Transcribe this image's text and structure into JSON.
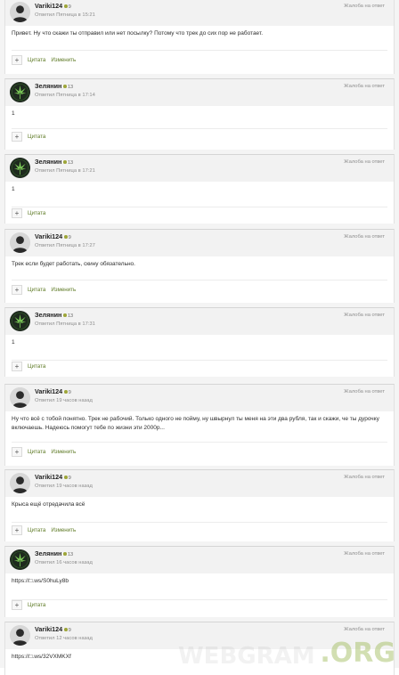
{
  "labels": {
    "report": "Жалоба на ответ",
    "quote": "Цитата",
    "edit": "Изменить"
  },
  "posts": [
    {
      "author": "Variki124",
      "rep": "9",
      "meta": "Ответил Пятница в 15:21",
      "text": "Привет. Ну что скажи ты отправил или нет посылку? Потому что трек до сих пор не работает.",
      "avatar": "user-avatar-gray",
      "can_edit": true
    },
    {
      "author": "Зелянин",
      "rep": "13",
      "meta": "Ответил Пятница в 17:14",
      "text": "1",
      "avatar": "cannabis-leaf-avatar",
      "can_edit": false
    },
    {
      "author": "Зелянин",
      "rep": "13",
      "meta": "Ответил Пятница в 17:21",
      "text": "1",
      "avatar": "cannabis-leaf-avatar",
      "can_edit": false
    },
    {
      "author": "Variki124",
      "rep": "9",
      "meta": "Ответил Пятница в 17:27",
      "text": "Трек если будет работать, скину обязательно.",
      "avatar": "user-avatar-gray",
      "can_edit": true
    },
    {
      "author": "Зелянин",
      "rep": "13",
      "meta": "Ответил Пятница в 17:31",
      "text": "1",
      "avatar": "cannabis-leaf-avatar",
      "can_edit": false
    },
    {
      "author": "Variki124",
      "rep": "9",
      "meta": "Ответил 19 часов назад",
      "text": "Ну что всё с тобой понятно. Трек не рабочий. Только одного не пойму, ну швырнул ты меня на эти два рубля, так и скажи, че ты дурочку включаешь. Надеюсь помогут тебе по жизни эти 2000р...",
      "avatar": "user-avatar-gray",
      "can_edit": true
    },
    {
      "author": "Variki124",
      "rep": "9",
      "meta": "Ответил 19 часов назад",
      "text": "Крыса ещё отредачила всё",
      "avatar": "user-avatar-gray",
      "can_edit": true
    },
    {
      "author": "Зелянин",
      "rep": "13",
      "meta": "Ответил 16 часов назад",
      "text": "https://□.ws/S0huLy8b",
      "avatar": "cannabis-leaf-avatar",
      "can_edit": false
    },
    {
      "author": "Variki124",
      "rep": "9",
      "meta": "Ответил 12 часов назад",
      "text": "https://□.ws/32VXMKXf",
      "avatar": "user-avatar-gray",
      "can_edit": true
    }
  ],
  "watermark": ".ORG",
  "watermark_ghost": "WEBGRAM"
}
